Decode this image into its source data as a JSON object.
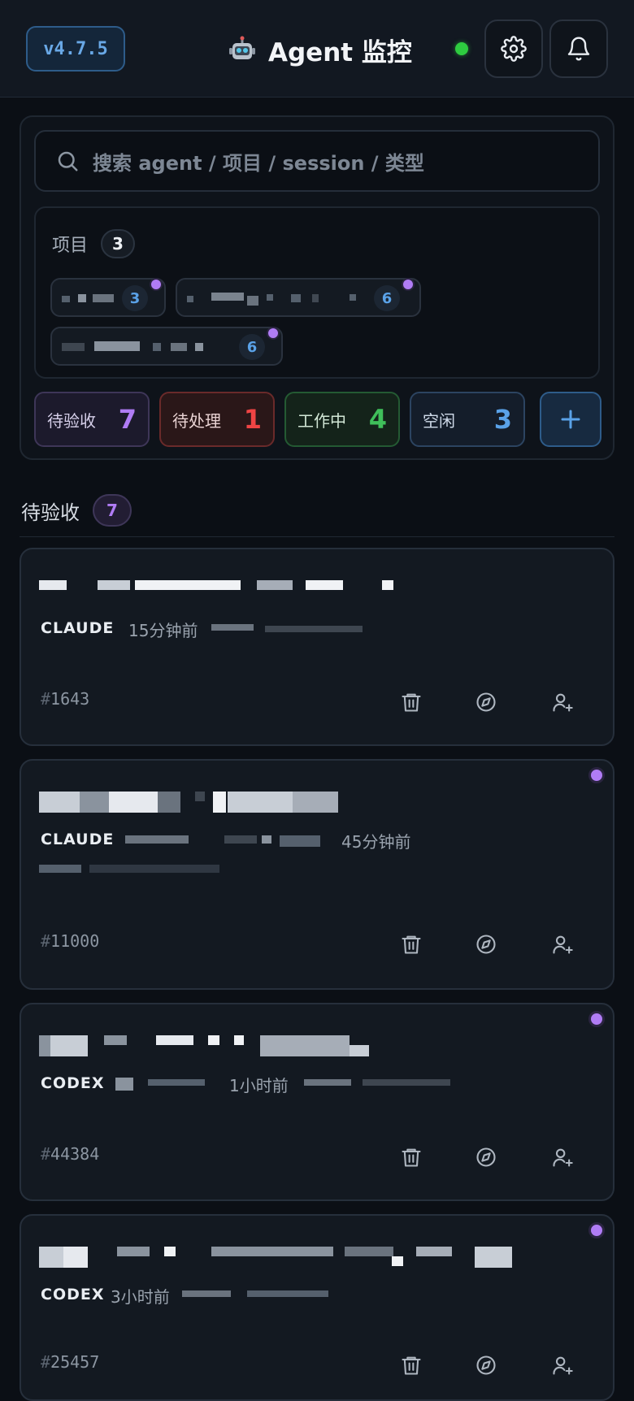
{
  "header": {
    "version": "v4.7.5",
    "title": "Agent 监控",
    "icons": {
      "logo": "robot-icon",
      "settings": "gear-icon",
      "notifications": "bell-icon"
    },
    "status_color": "#2ecc40"
  },
  "search": {
    "placeholder": "搜索 agent / 项目 / session / 类型"
  },
  "projects": {
    "label": "项目",
    "count": "3",
    "chips": [
      {
        "count": "3"
      },
      {
        "count": "6"
      },
      {
        "count": "6"
      }
    ]
  },
  "stats": [
    {
      "label": "待验收",
      "value": "7",
      "color": "#b07cf5"
    },
    {
      "label": "待处理",
      "value": "1",
      "color": "#ef4444"
    },
    {
      "label": "工作中",
      "value": "4",
      "color": "#3fbf5a"
    },
    {
      "label": "空闲",
      "value": "3",
      "color": "#5aa2e8"
    }
  ],
  "section": {
    "title": "待验收",
    "count": "7"
  },
  "cards": [
    {
      "type": "CLAUDE",
      "time": "15分钟前",
      "hash": "#",
      "id": "1643",
      "unread": false
    },
    {
      "type": "CLAUDE",
      "time": "45分钟前",
      "hash": "#",
      "id": "11000",
      "unread": true
    },
    {
      "type": "CODEX",
      "time": "1小时前",
      "hash": "#",
      "id": "44384",
      "unread": true
    },
    {
      "type": "CODEX",
      "time": "3小时前",
      "hash": "#",
      "id": "25457",
      "unread": true
    }
  ],
  "card_actions": {
    "delete": "trash-icon",
    "open": "compass-icon",
    "assign": "user-plus-icon"
  }
}
